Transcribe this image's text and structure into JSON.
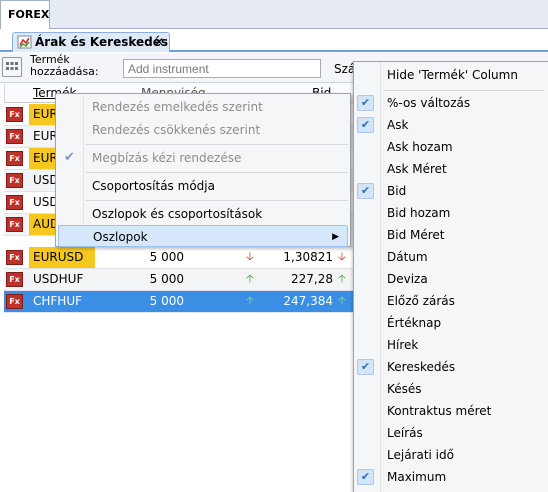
{
  "app_tab": {
    "label": "FOREX"
  },
  "doc_tab": {
    "label": "Árak és Kereskedés",
    "close_glyph": "✕"
  },
  "toolbar": {
    "add_label_line1": "Termék",
    "add_label_line2": "hozzáadása:",
    "add_placeholder": "Add instrument",
    "szam_label": "Szám"
  },
  "grid": {
    "headers": {
      "termek": "Termék",
      "mennyiseg": "Mennyiség",
      "bid": "Bid"
    },
    "rows": [
      {
        "icon": "Fx",
        "symbol": "EUR",
        "qty": "",
        "bid": "",
        "hl": true
      },
      {
        "icon": "Fx",
        "symbol": "EUR",
        "qty": "",
        "bid": "",
        "hl": false
      },
      {
        "icon": "Fx",
        "symbol": "EUR",
        "qty": "",
        "bid": "",
        "hl": true
      },
      {
        "icon": "Fx",
        "symbol": "USD",
        "qty": "",
        "bid": "",
        "hl": false
      },
      {
        "icon": "Fx",
        "symbol": "USD",
        "qty": "",
        "bid": "",
        "hl": false
      },
      {
        "icon": "Fx",
        "symbol": "AUD",
        "qty": "",
        "bid": "",
        "hl": true
      },
      {
        "icon": "Fx",
        "symbol": "EURUSD",
        "qty": "5 000",
        "bid": "1,30821",
        "hl": true
      },
      {
        "icon": "Fx",
        "symbol": "USDHUF",
        "qty": "5 000",
        "bid": "227,28",
        "hl": false
      },
      {
        "icon": "Fx",
        "symbol": "CHFHUF",
        "qty": "5 000",
        "bid": "247,384",
        "hl": false
      }
    ]
  },
  "context_menu": {
    "sort_asc": "Rendezés emelkedés szerint",
    "sort_desc": "Rendezés csökkenés szerint",
    "manual_order": "Megbízás kézi rendezése",
    "grouping": "Csoportosítás módja",
    "choose_columns": "Oszlopok és csoportosítások kiválasztása...",
    "columns": "Oszlopok",
    "check_glyph": "✔",
    "submenu_arrow": "▶"
  },
  "columns_menu": {
    "hide": "Hide 'Termék' Column",
    "check_glyph": "✔",
    "items": [
      {
        "label": "%-os változás",
        "checked": true
      },
      {
        "label": "Ask",
        "checked": true
      },
      {
        "label": "Ask hozam",
        "checked": false
      },
      {
        "label": "Ask Méret",
        "checked": false
      },
      {
        "label": "Bid",
        "checked": true
      },
      {
        "label": "Bid hozam",
        "checked": false
      },
      {
        "label": "Bid Méret",
        "checked": false
      },
      {
        "label": "Dátum",
        "checked": false
      },
      {
        "label": "Deviza",
        "checked": false
      },
      {
        "label": "Előző zárás",
        "checked": false
      },
      {
        "label": "Értéknap",
        "checked": false
      },
      {
        "label": "Hírek",
        "checked": false
      },
      {
        "label": "Kereskedés",
        "checked": true
      },
      {
        "label": "Késés",
        "checked": false
      },
      {
        "label": "Kontraktus méret",
        "checked": false
      },
      {
        "label": "Leírás",
        "checked": false
      },
      {
        "label": "Lejárati idő",
        "checked": false
      },
      {
        "label": "Maximum",
        "checked": true
      }
    ]
  }
}
